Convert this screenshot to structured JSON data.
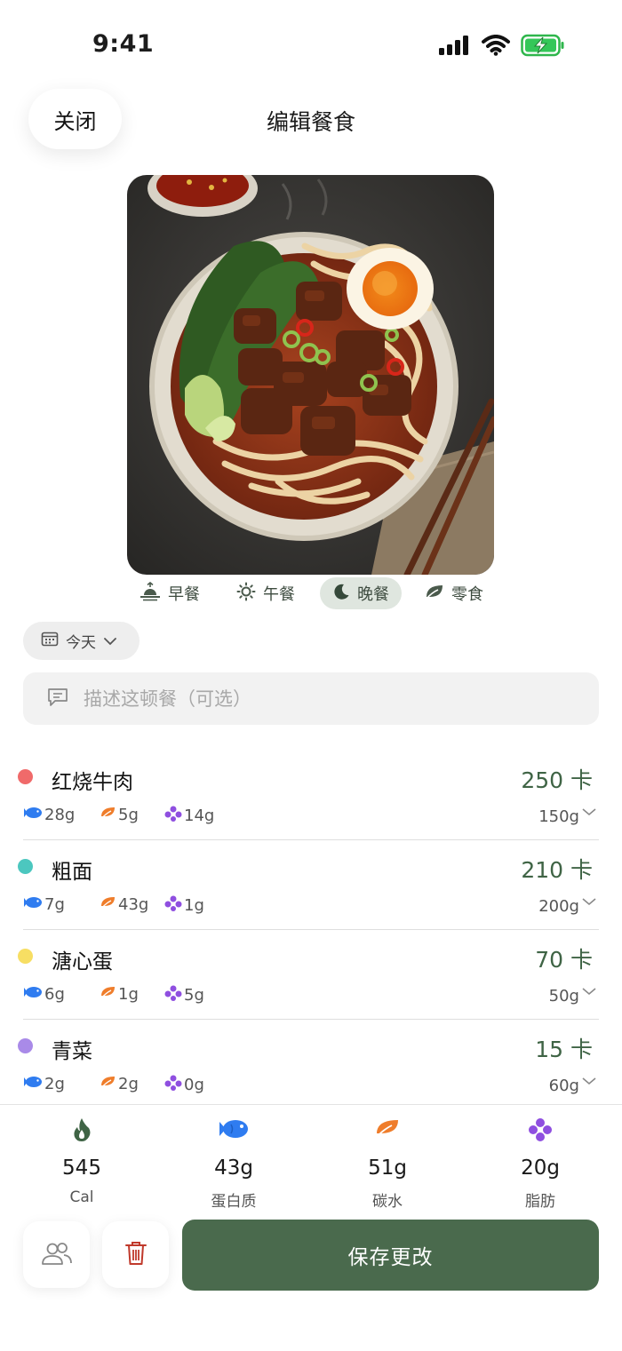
{
  "status": {
    "time": "9:41"
  },
  "header": {
    "close_label": "关闭",
    "title": "编辑餐食"
  },
  "meal_types": [
    {
      "label": "早餐",
      "icon": "sunrise-icon",
      "active": false
    },
    {
      "label": "午餐",
      "icon": "sun-icon",
      "active": false
    },
    {
      "label": "晚餐",
      "icon": "moon-icon",
      "active": true
    },
    {
      "label": "零食",
      "icon": "leaf-icon",
      "active": false
    }
  ],
  "date": {
    "label": "今天"
  },
  "description": {
    "placeholder": "描述这顿餐（可选）",
    "value": ""
  },
  "foods": [
    {
      "name": "红烧牛肉",
      "calories": "250 卡",
      "protein": "28g",
      "carbs": "5g",
      "fat": "14g",
      "weight": "150g",
      "color": "#f06a6a"
    },
    {
      "name": "粗面",
      "calories": "210 卡",
      "protein": "7g",
      "carbs": "43g",
      "fat": "1g",
      "weight": "200g",
      "color": "#4cc7bf"
    },
    {
      "name": "溏心蛋",
      "calories": "70 卡",
      "protein": "6g",
      "carbs": "1g",
      "fat": "5g",
      "weight": "50g",
      "color": "#f7de63"
    },
    {
      "name": "青菜",
      "calories": "15 卡",
      "protein": "2g",
      "carbs": "2g",
      "fat": "0g",
      "weight": "60g",
      "color": "#a98ae8"
    }
  ],
  "summary": {
    "calories": {
      "value": "545",
      "label": "Cal"
    },
    "protein": {
      "value": "43g",
      "label": "蛋白质"
    },
    "carbs": {
      "value": "51g",
      "label": "碳水"
    },
    "fat": {
      "value": "20g",
      "label": "脂肪"
    }
  },
  "actions": {
    "save_label": "保存更改"
  },
  "colors": {
    "accent": "#4a6a4d",
    "protein": "#2f7cf0",
    "carbs": "#ef7d2b",
    "fat": "#8f4fe0",
    "calorie_text": "#3f6445"
  }
}
